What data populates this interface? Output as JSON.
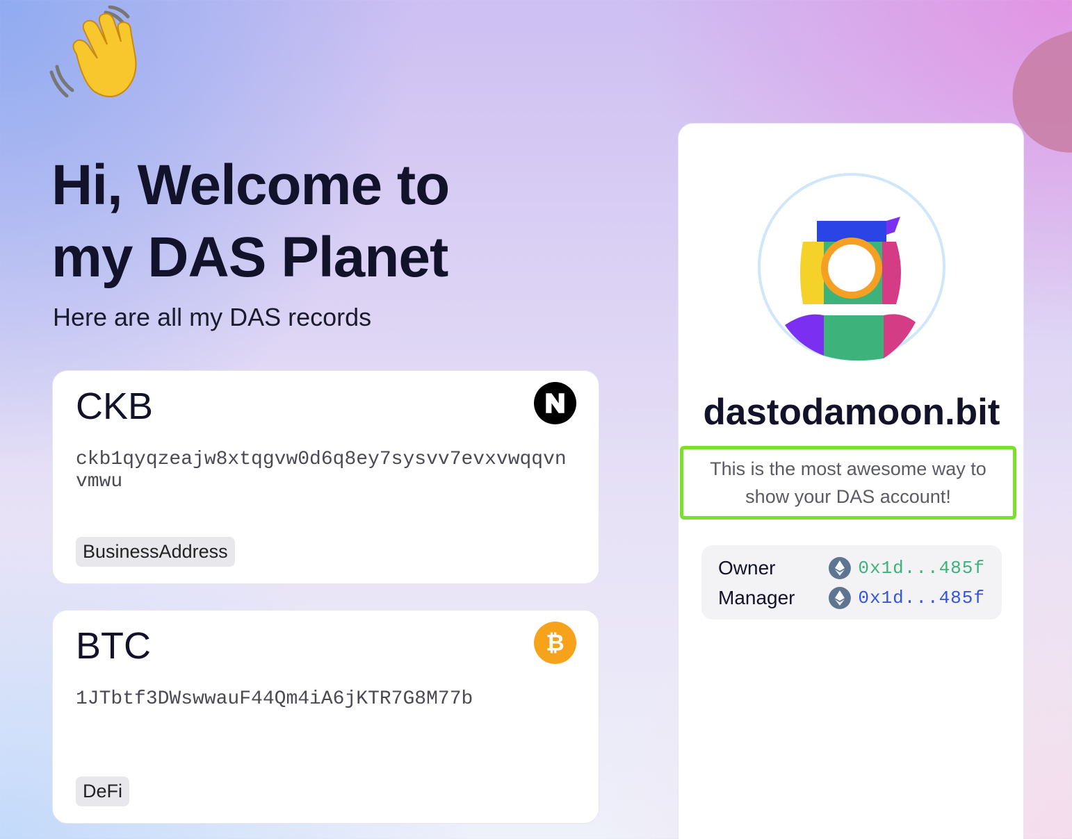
{
  "hero": {
    "icon": "waving-hand-icon",
    "title_line1": "Hi, Welcome to",
    "title_line2": "my DAS Planet",
    "subtitle": "Here are all my DAS records"
  },
  "records": [
    {
      "coin": "CKB",
      "address": "ckb1qyqzeajw8xtqgvw0d6q8ey7sysvv7evxvwqqvnvmwu",
      "tag": "BusinessAddress",
      "icon": "nervos-ckb-icon",
      "icon_color": "#000000"
    },
    {
      "coin": "BTC",
      "address": "1JTbtf3DWswwauF44Qm4iA6jKTR7G8M77b",
      "tag": "DeFi",
      "icon": "bitcoin-icon",
      "icon_color": "#f7a21b"
    }
  ],
  "profile": {
    "avatar_icon": "das-logo-icon",
    "account_name": "dastodamoon.bit",
    "bio": "This is the most awesome way to show your DAS account!",
    "bio_border_color": "#7ae02a",
    "roles": [
      {
        "label": "Owner",
        "address": "0x1d...485f",
        "icon": "ethereum-icon",
        "color": "#3cb37a"
      },
      {
        "label": "Manager",
        "address": "0x1d...485f",
        "icon": "ethereum-icon",
        "color": "#3355e0"
      }
    ]
  }
}
